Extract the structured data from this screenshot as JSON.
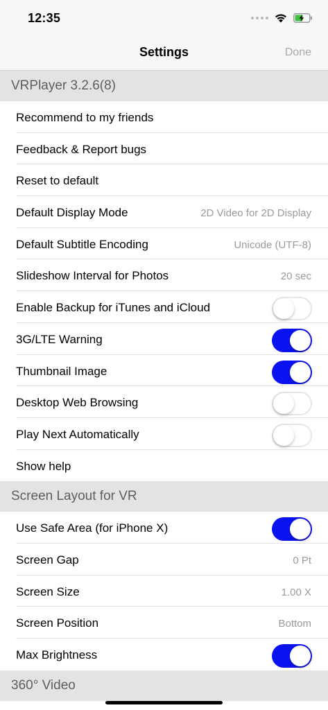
{
  "status_bar": {
    "time": "12:35"
  },
  "nav": {
    "title": "Settings",
    "done_label": "Done"
  },
  "sections": [
    {
      "header": "VRPlayer 3.2.6(8)",
      "rows": [
        {
          "label": "Recommend to my friends",
          "value": null,
          "toggle": null
        },
        {
          "label": "Feedback & Report bugs",
          "value": null,
          "toggle": null
        },
        {
          "label": "Reset to default",
          "value": null,
          "toggle": null
        },
        {
          "label": "Default Display Mode",
          "value": "2D Video for 2D Display",
          "toggle": null
        },
        {
          "label": "Default Subtitle Encoding",
          "value": "Unicode (UTF-8)",
          "toggle": null
        },
        {
          "label": "Slideshow Interval for Photos",
          "value": "20 sec",
          "toggle": null
        },
        {
          "label": "Enable Backup for iTunes and iCloud",
          "value": null,
          "toggle": false
        },
        {
          "label": "3G/LTE Warning",
          "value": null,
          "toggle": true
        },
        {
          "label": "Thumbnail Image",
          "value": null,
          "toggle": true
        },
        {
          "label": "Desktop Web Browsing",
          "value": null,
          "toggle": false
        },
        {
          "label": "Play Next Automatically",
          "value": null,
          "toggle": false
        },
        {
          "label": "Show help",
          "value": null,
          "toggle": null
        }
      ]
    },
    {
      "header": "Screen Layout for VR",
      "rows": [
        {
          "label": "Use Safe Area (for iPhone X)",
          "value": null,
          "toggle": true
        },
        {
          "label": "Screen Gap",
          "value": "0 Pt",
          "toggle": null
        },
        {
          "label": "Screen Size",
          "value": "1.00 X",
          "toggle": null
        },
        {
          "label": "Screen Position",
          "value": "Bottom",
          "toggle": null
        },
        {
          "label": "Max Brightness",
          "value": null,
          "toggle": true
        }
      ]
    },
    {
      "header": "360° Video",
      "rows": []
    }
  ],
  "colors": {
    "toggle_on": "#0a12f0",
    "section_header_bg": "#e3e3e3",
    "done_disabled": "#a9a9a9"
  },
  "icons": [
    "wifi-icon",
    "battery-charging-icon",
    "signal-dots-icon"
  ]
}
